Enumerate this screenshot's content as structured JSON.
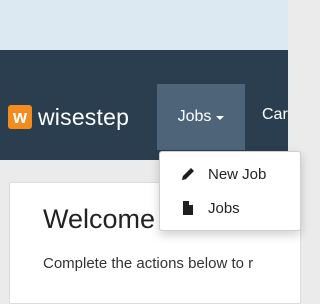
{
  "brand": {
    "logo_letter": "w",
    "name": "wisestep"
  },
  "nav": {
    "jobs_label": "Jobs",
    "next_label": "Car"
  },
  "dropdown": {
    "items": [
      {
        "label": "New Job",
        "icon": "pencil-icon"
      },
      {
        "label": "Jobs",
        "icon": "document-icon"
      }
    ]
  },
  "main": {
    "title": "Welcome",
    "subtitle": "Complete the actions below to r"
  },
  "colors": {
    "navbar": "#2b3e50",
    "nav_active": "#4e6478",
    "logo": "#f28c1e",
    "top_strip": "#dce9f2",
    "page_bg": "#ebebeb"
  }
}
